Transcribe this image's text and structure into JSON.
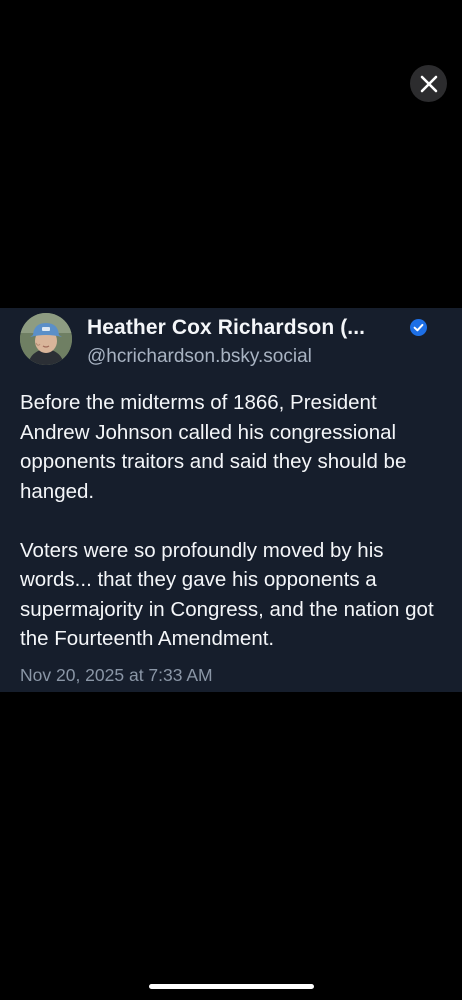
{
  "viewer": {
    "close_icon": "close-icon"
  },
  "post": {
    "author": {
      "display_name": "Heather Cox Richardson (...",
      "handle": "@hcrichardson.bsky.social",
      "verified": true,
      "avatar_icon": "avatar-photo",
      "verified_icon": "verified-check-icon"
    },
    "paragraphs": [
      "Before the midterms of 1866, President Andrew Johnson called his congressional opponents traitors and said they should be hanged.",
      "Voters were so profoundly moved by his words... that they gave his opponents a supermajority in Congress, and the nation got the Fourteenth Amendment."
    ],
    "timestamp": "Nov 20, 2025 at 7:33 AM"
  },
  "colors": {
    "background": "#000000",
    "card": "#161e2c",
    "text": "#f4f6f9",
    "secondary_text": "#a8b3c2",
    "timestamp": "#8a96a6",
    "verified": "#1d6fe6"
  }
}
